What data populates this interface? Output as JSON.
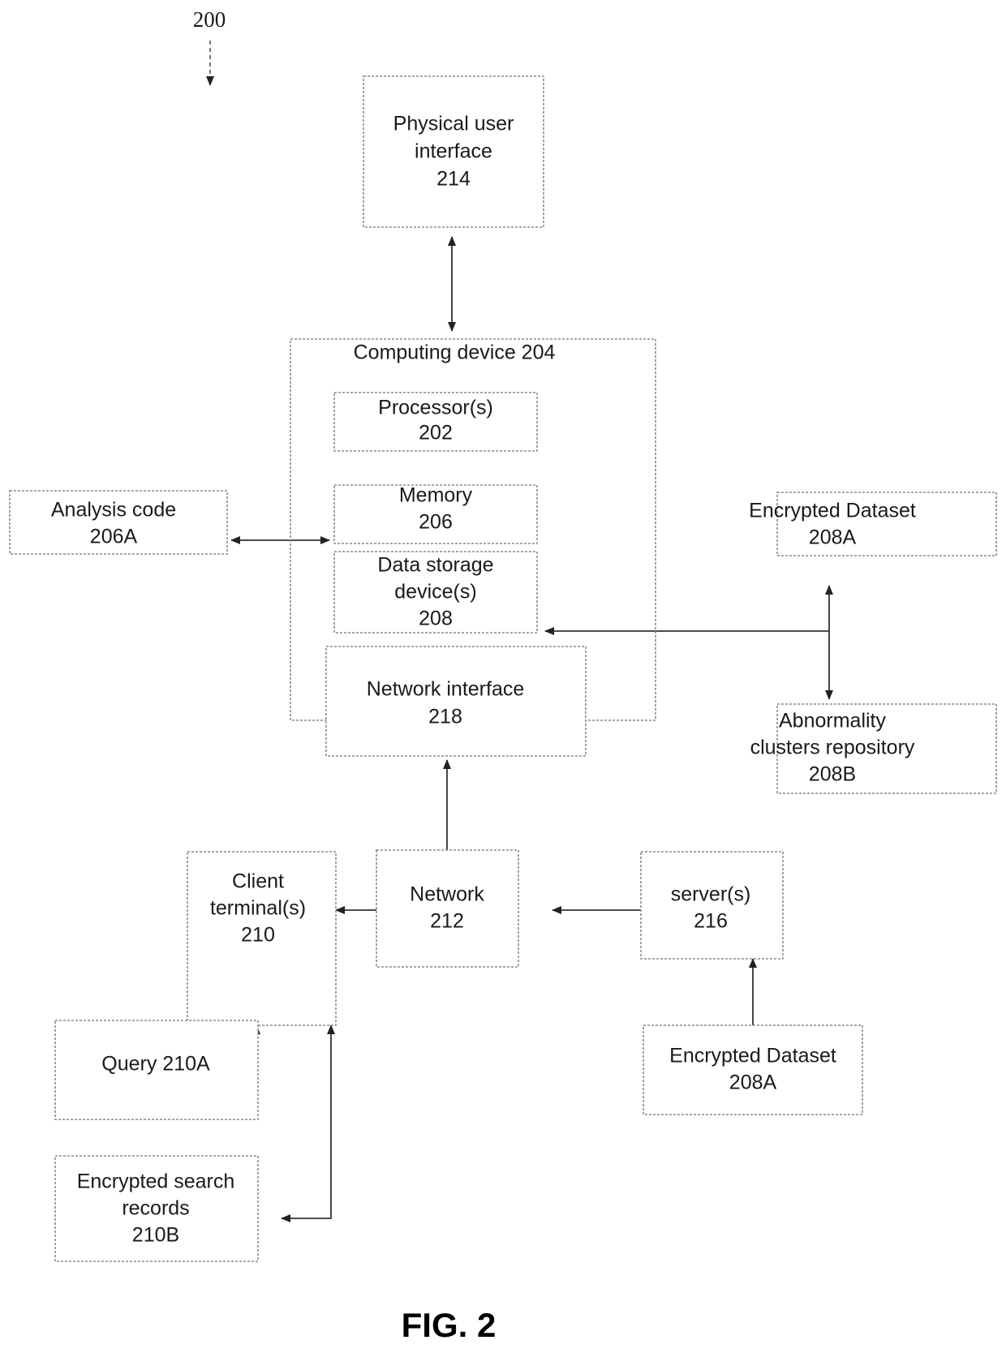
{
  "figure": {
    "label": "FIG. 2",
    "diagram_ref": "200"
  },
  "nodes": {
    "physical_user_interface": {
      "line1": "Physical user",
      "line2": "interface",
      "ref": "214"
    },
    "computing_device": {
      "title": "Computing device 204"
    },
    "processors": {
      "line1": "Processor(s)",
      "ref": "202"
    },
    "memory": {
      "line1": "Memory",
      "ref": "206"
    },
    "data_storage": {
      "line1": "Data storage",
      "line2": "device(s)",
      "ref": "208"
    },
    "network_interface": {
      "line1": "Network interface",
      "ref": "218"
    },
    "analysis_code": {
      "line1": "Analysis code",
      "ref": "206A"
    },
    "encrypted_dataset_right": {
      "line1": "Encrypted Dataset",
      "ref": "208A"
    },
    "abnormality_clusters": {
      "line1": "Abnormality",
      "line2": "clusters repository",
      "ref": "208B"
    },
    "client_terminals": {
      "line1": "Client",
      "line2": "terminal(s)",
      "ref": "210"
    },
    "network": {
      "line1": "Network",
      "ref": "212"
    },
    "servers": {
      "line1": "server(s)",
      "ref": "216"
    },
    "query": {
      "line1": "Query 210A"
    },
    "encrypted_search_records": {
      "line1": "Encrypted search",
      "line2": "records",
      "ref": "210B"
    },
    "encrypted_dataset_bottom": {
      "line1": "Encrypted Dataset",
      "ref": "208A"
    }
  },
  "colors": {
    "line": "#333333",
    "box_stroke": "#8a8a8a",
    "text": "#1a1a1a",
    "background": "#ffffff"
  }
}
